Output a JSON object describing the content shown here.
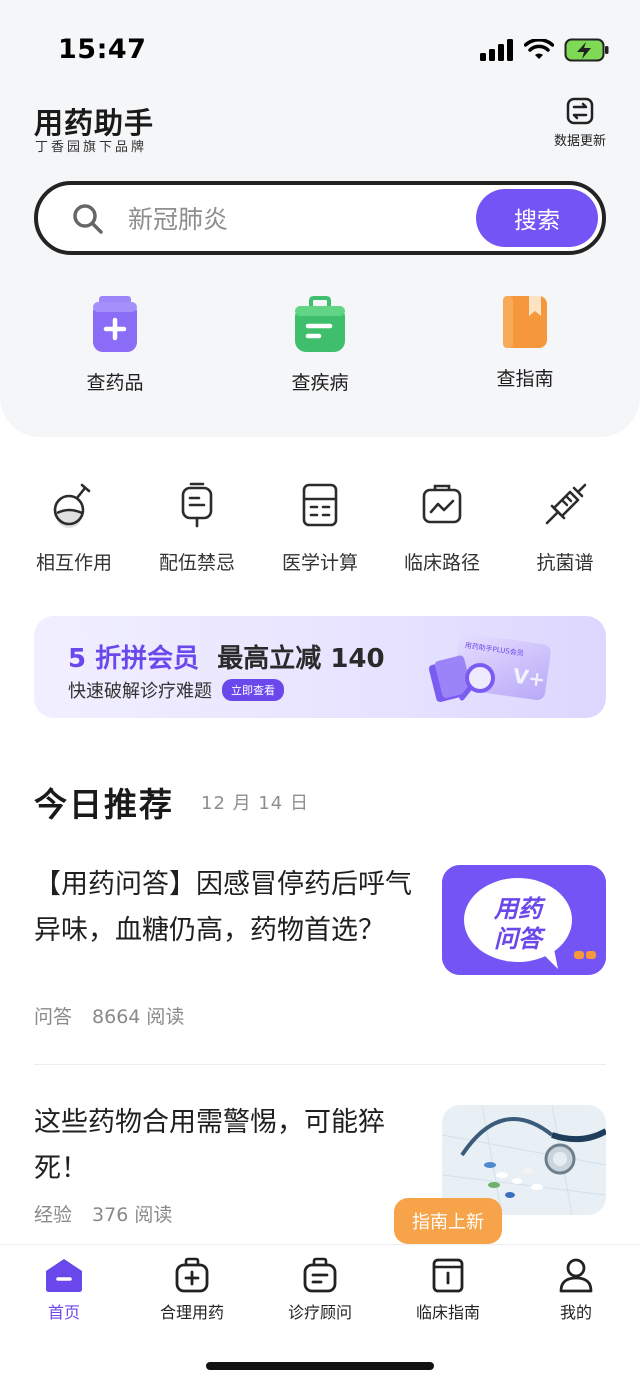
{
  "status_bar": {
    "time": "15:47"
  },
  "header": {
    "title": "用药助手",
    "subtitle": "丁香园旗下品牌",
    "update_label": "数据更新"
  },
  "search": {
    "placeholder": "新冠肺炎",
    "button_label": "搜索"
  },
  "main_categories": [
    {
      "label": "查药品",
      "icon": "medicine-bottle-icon",
      "color": "#8a6cf7"
    },
    {
      "label": "查疾病",
      "icon": "medical-bag-icon",
      "color": "#3fbf6b"
    },
    {
      "label": "查指南",
      "icon": "guide-book-icon",
      "color": "#f5983c"
    }
  ],
  "tools": [
    {
      "label": "相互作用",
      "icon": "flask-icon"
    },
    {
      "label": "配伍禁忌",
      "icon": "iv-bag-icon"
    },
    {
      "label": "医学计算",
      "icon": "calculator-icon"
    },
    {
      "label": "临床路径",
      "icon": "clinical-path-icon"
    },
    {
      "label": "抗菌谱",
      "icon": "syringe-icon"
    }
  ],
  "banner": {
    "highlight": "5 折拼会员",
    "headline": "最高立减 140",
    "subtitle": "快速破解诊疗难题",
    "cta": "立即查看",
    "card_text": "用药助手PLUS会员"
  },
  "recommend": {
    "title": "今日推荐",
    "date": "12 月 14 日",
    "articles": [
      {
        "title": "【用药问答】因感冒停药后呼气异味，血糖仍高，药物首选？",
        "category": "问答",
        "reads": "8664 阅读",
        "thumb_text": "用药问答"
      },
      {
        "title": "这些药物合用需警惕，可能猝死！",
        "category": "经验",
        "reads": "376 阅读",
        "thumb_text": ""
      }
    ]
  },
  "tooltip": {
    "text": "指南上新"
  },
  "tabbar": {
    "active_color": "#6a48ec",
    "tabs": [
      {
        "label": "首页",
        "icon": "home-icon",
        "active": true
      },
      {
        "label": "合理用药",
        "icon": "medicine-bag-icon",
        "active": false
      },
      {
        "label": "诊疗顾问",
        "icon": "consult-bag-icon",
        "active": false
      },
      {
        "label": "临床指南",
        "icon": "guide-icon",
        "active": false
      },
      {
        "label": "我的",
        "icon": "profile-icon",
        "active": false
      }
    ]
  },
  "colors": {
    "accent": "#7454f5",
    "tooltip": "#f7a34a",
    "background_top": "#f5f6f8"
  }
}
